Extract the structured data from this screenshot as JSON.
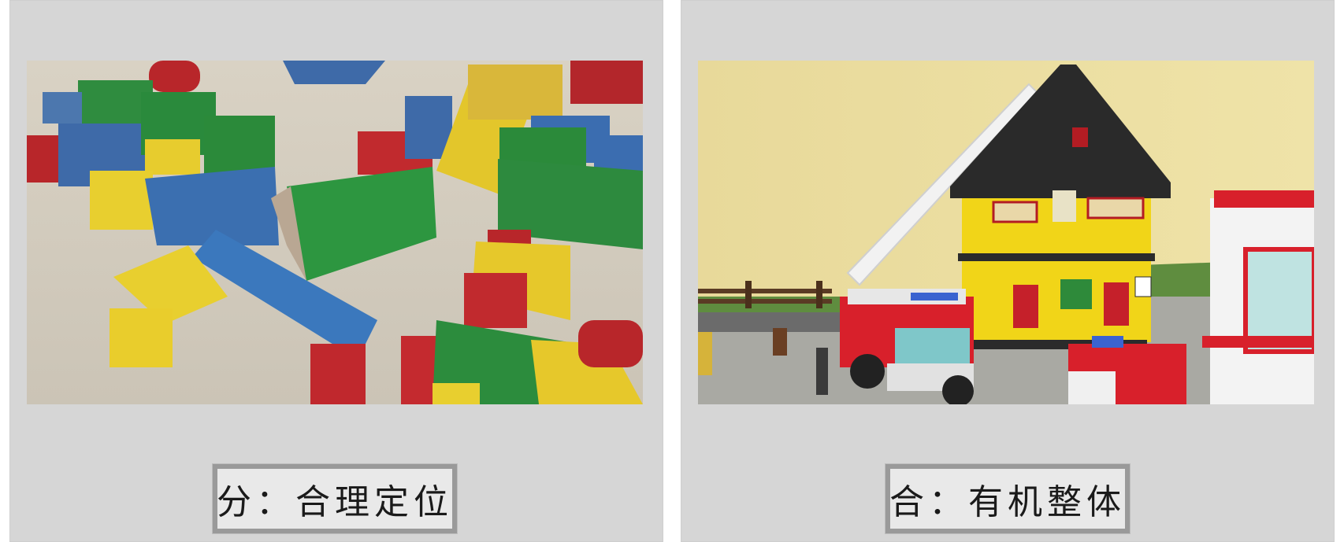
{
  "panels": [
    {
      "image_subject": "wooden-blocks-photo",
      "caption": "分：合理定位"
    },
    {
      "image_subject": "lego-fire-station-photo",
      "caption": "合：有机整体"
    }
  ],
  "colors": {
    "card_background": "#d6d6d6",
    "caption_border": "#9a9a9a",
    "caption_background": "#e9e9e9"
  }
}
